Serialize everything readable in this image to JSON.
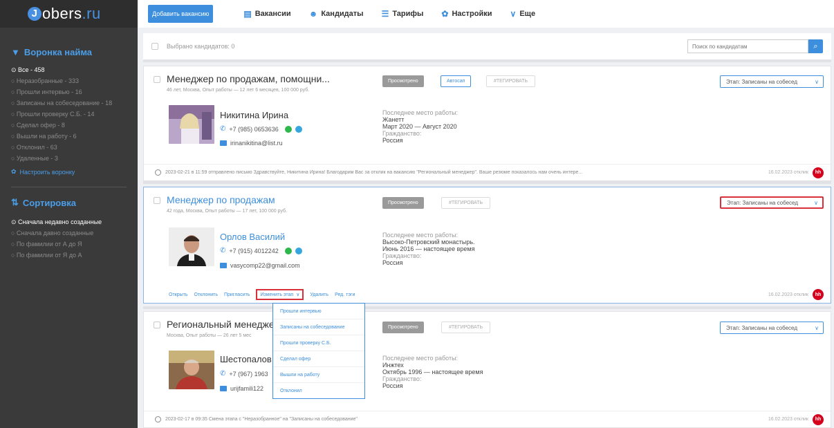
{
  "brand": {
    "j": "J",
    "name": "obers",
    "tld": ".ru"
  },
  "sidebar": {
    "funnel_title": "Воронка найма",
    "funnel_items": [
      {
        "label": "⊙ Все - 458",
        "active": true
      },
      {
        "label": "○ Неразобранные - 333",
        "active": false
      },
      {
        "label": "○ Прошли интервью - 16",
        "active": false
      },
      {
        "label": "○ Записаны на собеседование - 18",
        "active": false
      },
      {
        "label": "○ Прошли проверку С.Б. - 14",
        "active": false
      },
      {
        "label": "○ Сделал офер - 8",
        "active": false
      },
      {
        "label": "○ Вышли на работу - 6",
        "active": false
      },
      {
        "label": "○ Отклонил - 63",
        "active": false
      },
      {
        "label": "○ Удаленные - 3",
        "active": false
      }
    ],
    "setup_funnel": "Настроить воронку",
    "sort_title": "Сортировка",
    "sort_items": [
      {
        "label": "⊙ Сначала недавно созданные",
        "active": true
      },
      {
        "label": "○ Сначала давно созданные",
        "active": false
      },
      {
        "label": "○ По фамилии от А до Я",
        "active": false
      },
      {
        "label": "○ По фамилии от Я до А",
        "active": false
      }
    ]
  },
  "topbar": {
    "add_vacancy": "Добавить вакансию",
    "nav": [
      "Вакансии",
      "Кандидаты",
      "Тарифы",
      "Настройки",
      "Еще"
    ]
  },
  "toolbar": {
    "selected": "Выбрано кандидатов: 0",
    "search_placeholder": "Поиск по кандидатам"
  },
  "cards": [
    {
      "title": "Менеджер по продажам, помощни...",
      "subtitle": "46 лет, Москва, Опыт работы — 12 лет 6 месяцев, 100 000 руб.",
      "viewed": "Просмотрено",
      "auto": "Автосап",
      "tag": "#ТЕГИРОВАТЬ",
      "stage": "Этап: Записаны на собесед",
      "name": "Никитина Ирина",
      "phone": "+7 (985) 0653636",
      "email": "irinanikitina@list.ru",
      "work_label": "Последнее место работы:",
      "work_company": "Жанетт",
      "work_period": "Март 2020 — Август 2020",
      "citizen_label": "Гражданство:",
      "citizen": "Россия",
      "footer": "2023-02-21 в 11:59 отправлено письмо Здравствуйте, Никитина Ирина! Благодарим Вас за отклик на вакансию \"Региональный менеджер\". Ваше резюме показалось нам очень интере...",
      "date": "16.02.2023 отклик",
      "hh": "hh"
    },
    {
      "title": "Менеджер по продажам",
      "subtitle": "42 года, Москва, Опыт работы — 17 лет, 100 000 руб.",
      "viewed": "Просмотрено",
      "tag": "#ТЕГИРОВАТЬ",
      "stage": "Этап: Записаны на собесед",
      "name": "Орлов Василий",
      "phone": "+7 (915) 4012242",
      "email": "vasycomp22@gmail.com",
      "work_label": "Последнее место работы:",
      "work_company": "Высоко-Петровский монастырь.",
      "work_period": "Июнь 2016 — настоящее время",
      "citizen_label": "Гражданство:",
      "citizen": "Россия",
      "actions": [
        "Открыть",
        "Отклонить",
        "Пригласить",
        "Изменить этап",
        "Удалить",
        "Ред. тэги"
      ],
      "date": "16.02.2023 отклик",
      "hh": "hh"
    },
    {
      "title": "Региональный менеджер",
      "subtitle": "Москва, Опыт работы — 26 лет 5 мес",
      "viewed": "Просмотрено",
      "tag": "#ТЕГИРОВАТЬ",
      "stage": "Этап: Записаны на собесед",
      "name": "Шестопалов",
      "phone": "+7 (967) 1963",
      "email": "urijfamili122",
      "work_label": "Последнее место работы:",
      "work_company": "Инжтех",
      "work_period": "Октябрь 1996 — настоящее время",
      "citizen_label": "Гражданство:",
      "citizen": "Россия",
      "footer": "2023-02-17 в 09:35 Смена этапа с \"Неразобранное\" на \"Записаны на собеседование\"",
      "date": "16.02.2023 отклик",
      "hh": "hh"
    }
  ],
  "stage_menu": [
    "Прошли интервью",
    "Записаны на собеседование",
    "Прошли проверку С.Б.",
    "Сделал офер",
    "Вышли на работу",
    "Отклонил"
  ],
  "colors": {
    "accent": "#3d8fdd",
    "sidebar": "#3a3a3a",
    "highlight": "#d9303a",
    "hh": "#d6001c"
  }
}
